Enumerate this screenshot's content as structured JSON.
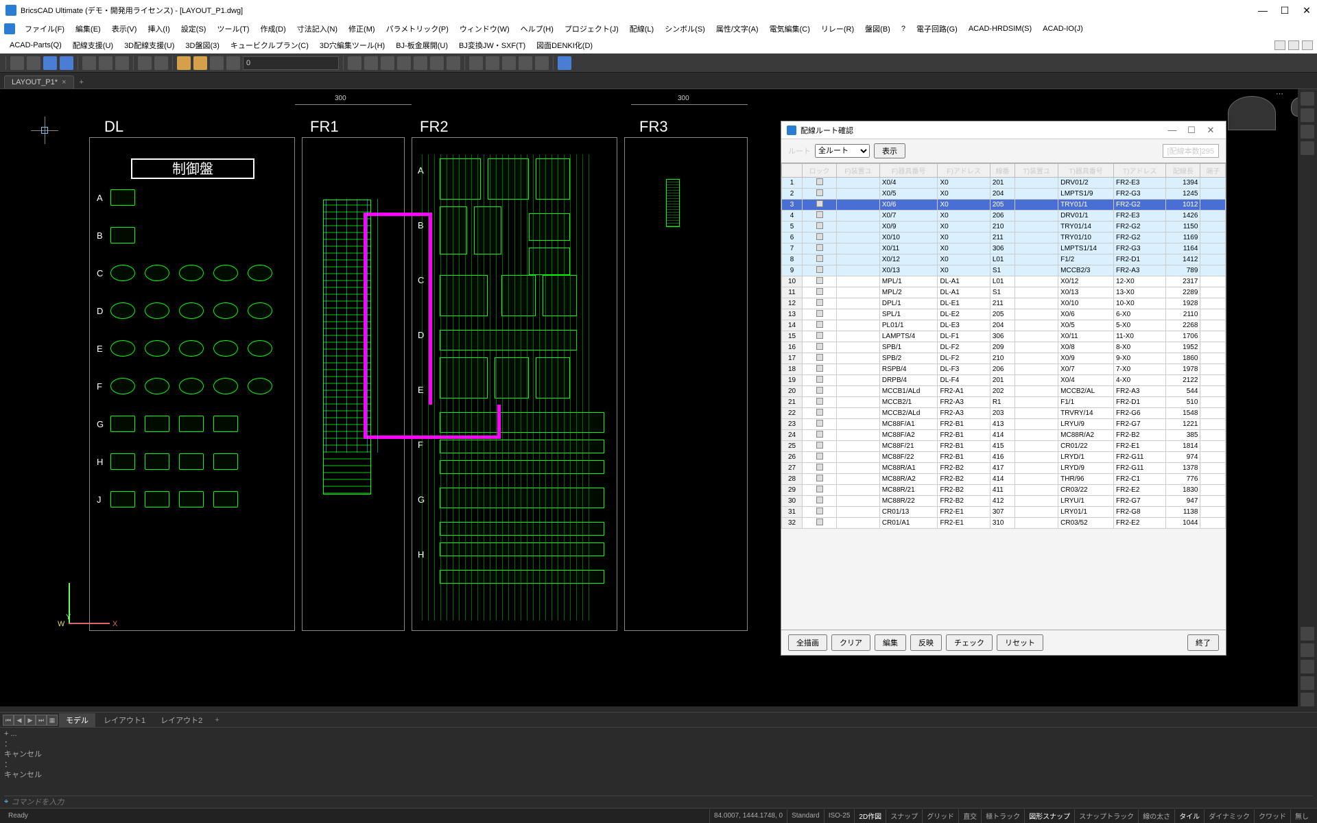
{
  "title": "BricsCAD Ultimate (デモ・開発用ライセンス) - [LAYOUT_P1.dwg]",
  "menu1": [
    "ファイル(F)",
    "編集(E)",
    "表示(V)",
    "挿入(I)",
    "設定(S)",
    "ツール(T)",
    "作成(D)",
    "寸法記入(N)",
    "修正(M)",
    "パラメトリック(P)",
    "ウィンドウ(W)",
    "ヘルプ(H)",
    "プロジェクト(J)",
    "配線(L)",
    "シンボル(S)",
    "属性/文字(A)",
    "電気編集(C)",
    "リレー(R)",
    "盤図(B)",
    "?",
    "電子回路(G)",
    "ACAD-HRDSIM(S)",
    "ACAD-IO(J)"
  ],
  "menu2": [
    "ACAD-Parts(Q)",
    "配線支援(U)",
    "3D配線支援(U)",
    "3D盤図(3)",
    "キュービクルプラン(C)",
    "3D穴編集ツール(H)",
    "BJ-板金展開(U)",
    "BJ変換JW・SXF(T)",
    "図面DENKI化(D)"
  ],
  "toolbar_layer": "0",
  "tab": {
    "name": "LAYOUT_P1*"
  },
  "canvas": {
    "labels": {
      "DL": "DL",
      "FR1": "FR1",
      "FR2": "FR2",
      "FR3": "FR3",
      "panel": "制御盤"
    },
    "rows": [
      "A",
      "B",
      "C",
      "D",
      "E",
      "F",
      "G",
      "H",
      "J"
    ],
    "fr2_rows": [
      "A",
      "B",
      "C",
      "D",
      "E",
      "F",
      "G",
      "H"
    ],
    "dims": {
      "d300a": "300",
      "d300b": "300"
    }
  },
  "dialog": {
    "title": "配線ルート確認",
    "route_label": "ルート",
    "route_value": "全ルート",
    "display": "表示",
    "count_label": "[配線本数]295",
    "headers": [
      "",
      "ロック",
      "F)装置ユ",
      "F)器具番号",
      "F)アドレス",
      "線番",
      "T)装置ユ",
      "T)器具番号",
      "T)アドレス",
      "配線長",
      "端子"
    ],
    "rows": [
      {
        "n": 1,
        "hl": true,
        "f_dev": "X0/4",
        "f_addr": "X0",
        "line": "201",
        "t_dev": "DRV01/2",
        "t_addr": "FR2-E3",
        "len": 1394
      },
      {
        "n": 2,
        "hl": true,
        "f_dev": "X0/5",
        "f_addr": "X0",
        "line": "204",
        "t_dev": "LMPTS1/9",
        "t_addr": "FR2-G3",
        "len": 1245
      },
      {
        "n": 3,
        "sel": true,
        "f_dev": "X0/6",
        "f_addr": "X0",
        "line": "205",
        "t_dev": "TRY01/1",
        "t_addr": "FR2-G2",
        "len": 1012
      },
      {
        "n": 4,
        "hl": true,
        "f_dev": "X0/7",
        "f_addr": "X0",
        "line": "206",
        "t_dev": "DRV01/1",
        "t_addr": "FR2-E3",
        "len": 1426
      },
      {
        "n": 5,
        "hl": true,
        "f_dev": "X0/9",
        "f_addr": "X0",
        "line": "210",
        "t_dev": "TRY01/14",
        "t_addr": "FR2-G2",
        "len": 1150
      },
      {
        "n": 6,
        "hl": true,
        "f_dev": "X0/10",
        "f_addr": "X0",
        "line": "211",
        "t_dev": "TRY01/10",
        "t_addr": "FR2-G2",
        "len": 1169
      },
      {
        "n": 7,
        "hl": true,
        "f_dev": "X0/11",
        "f_addr": "X0",
        "line": "306",
        "t_dev": "LMPTS1/14",
        "t_addr": "FR2-G3",
        "len": 1164
      },
      {
        "n": 8,
        "hl": true,
        "f_dev": "X0/12",
        "f_addr": "X0",
        "line": "L01",
        "t_dev": "F1/2",
        "t_addr": "FR2-D1",
        "len": 1412
      },
      {
        "n": 9,
        "hl": true,
        "f_dev": "X0/13",
        "f_addr": "X0",
        "line": "S1",
        "t_dev": "MCCB2/3",
        "t_addr": "FR2-A3",
        "len": 789
      },
      {
        "n": 10,
        "f_dev": "MPL/1",
        "f_addr": "DL-A1",
        "line": "L01",
        "t_dev": "X0/12",
        "t_addr": "12-X0",
        "len": 2317
      },
      {
        "n": 11,
        "f_dev": "MPL/2",
        "f_addr": "DL-A1",
        "line": "S1",
        "t_dev": "X0/13",
        "t_addr": "13-X0",
        "len": 2289
      },
      {
        "n": 12,
        "f_dev": "DPL/1",
        "f_addr": "DL-E1",
        "line": "211",
        "t_dev": "X0/10",
        "t_addr": "10-X0",
        "len": 1928
      },
      {
        "n": 13,
        "f_dev": "SPL/1",
        "f_addr": "DL-E2",
        "line": "205",
        "t_dev": "X0/6",
        "t_addr": "6-X0",
        "len": 2110
      },
      {
        "n": 14,
        "f_dev": "PL01/1",
        "f_addr": "DL-E3",
        "line": "204",
        "t_dev": "X0/5",
        "t_addr": "5-X0",
        "len": 2268
      },
      {
        "n": 15,
        "f_dev": "LAMPTS/4",
        "f_addr": "DL-F1",
        "line": "306",
        "t_dev": "X0/11",
        "t_addr": "11-X0",
        "len": 1706
      },
      {
        "n": 16,
        "f_dev": "SPB/1",
        "f_addr": "DL-F2",
        "line": "209",
        "t_dev": "X0/8",
        "t_addr": "8-X0",
        "len": 1952
      },
      {
        "n": 17,
        "f_dev": "SPB/2",
        "f_addr": "DL-F2",
        "line": "210",
        "t_dev": "X0/9",
        "t_addr": "9-X0",
        "len": 1860
      },
      {
        "n": 18,
        "f_dev": "RSPB/4",
        "f_addr": "DL-F3",
        "line": "206",
        "t_dev": "X0/7",
        "t_addr": "7-X0",
        "len": 1978
      },
      {
        "n": 19,
        "f_dev": "DRPB/4",
        "f_addr": "DL-F4",
        "line": "201",
        "t_dev": "X0/4",
        "t_addr": "4-X0",
        "len": 2122
      },
      {
        "n": 20,
        "f_dev": "MCCB1/ALd",
        "f_addr": "FR2-A1",
        "line": "202",
        "t_dev": "MCCB2/AL",
        "t_addr": "FR2-A3",
        "len": 544
      },
      {
        "n": 21,
        "f_dev": "MCCB2/1",
        "f_addr": "FR2-A3",
        "line": "R1",
        "t_dev": "F1/1",
        "t_addr": "FR2-D1",
        "len": 510
      },
      {
        "n": 22,
        "f_dev": "MCCB2/ALd",
        "f_addr": "FR2-A3",
        "line": "203",
        "t_dev": "TRVRY/14",
        "t_addr": "FR2-G6",
        "len": 1548
      },
      {
        "n": 23,
        "f_dev": "MC88F/A1",
        "f_addr": "FR2-B1",
        "line": "413",
        "t_dev": "LRYU/9",
        "t_addr": "FR2-G7",
        "len": 1221
      },
      {
        "n": 24,
        "f_dev": "MC88F/A2",
        "f_addr": "FR2-B1",
        "line": "414",
        "t_dev": "MC88R/A2",
        "t_addr": "FR2-B2",
        "len": 385
      },
      {
        "n": 25,
        "f_dev": "MC88F/21",
        "f_addr": "FR2-B1",
        "line": "415",
        "t_dev": "CR01/22",
        "t_addr": "FR2-E1",
        "len": 1814
      },
      {
        "n": 26,
        "f_dev": "MC88F/22",
        "f_addr": "FR2-B1",
        "line": "416",
        "t_dev": "LRYD/1",
        "t_addr": "FR2-G11",
        "len": 974
      },
      {
        "n": 27,
        "f_dev": "MC88R/A1",
        "f_addr": "FR2-B2",
        "line": "417",
        "t_dev": "LRYD/9",
        "t_addr": "FR2-G11",
        "len": 1378
      },
      {
        "n": 28,
        "f_dev": "MC88R/A2",
        "f_addr": "FR2-B2",
        "line": "414",
        "t_dev": "THR/96",
        "t_addr": "FR2-C1",
        "len": 776
      },
      {
        "n": 29,
        "f_dev": "MC88R/21",
        "f_addr": "FR2-B2",
        "line": "411",
        "t_dev": "CR03/22",
        "t_addr": "FR2-E2",
        "len": 1830
      },
      {
        "n": 30,
        "f_dev": "MC88R/22",
        "f_addr": "FR2-B2",
        "line": "412",
        "t_dev": "LRYU/1",
        "t_addr": "FR2-G7",
        "len": 947
      },
      {
        "n": 31,
        "f_dev": "CR01/13",
        "f_addr": "FR2-E1",
        "line": "307",
        "t_dev": "LRY01/1",
        "t_addr": "FR2-G8",
        "len": 1138
      },
      {
        "n": 32,
        "f_dev": "CR01/A1",
        "f_addr": "FR2-E1",
        "line": "310",
        "t_dev": "CR03/52",
        "t_addr": "FR2-E2",
        "len": 1044
      }
    ],
    "buttons": {
      "redraw": "全描画",
      "clear": "クリア",
      "edit": "編集",
      "apply": "反映",
      "check": "チェック",
      "reset": "リセット",
      "close": "終了"
    }
  },
  "layout_tabs": {
    "model": "モデル",
    "l1": "レイアウト1",
    "l2": "レイアウト2"
  },
  "cmd": {
    "history": [
      "+  ...",
      "：",
      "キャンセル",
      "：",
      "キャンセル"
    ],
    "placeholder": "コマンドを入力"
  },
  "status": {
    "ready": "Ready",
    "coords": "84.0007, 1444.1748, 0",
    "segs": [
      "Standard",
      "ISO-25",
      "2D作図",
      "スナップ",
      "グリッド",
      "直交",
      "極トラック",
      "図形スナップ",
      "スナップトラック",
      "線の太さ",
      "タイル",
      "ダイナミック",
      "クワッド",
      "無し"
    ]
  }
}
